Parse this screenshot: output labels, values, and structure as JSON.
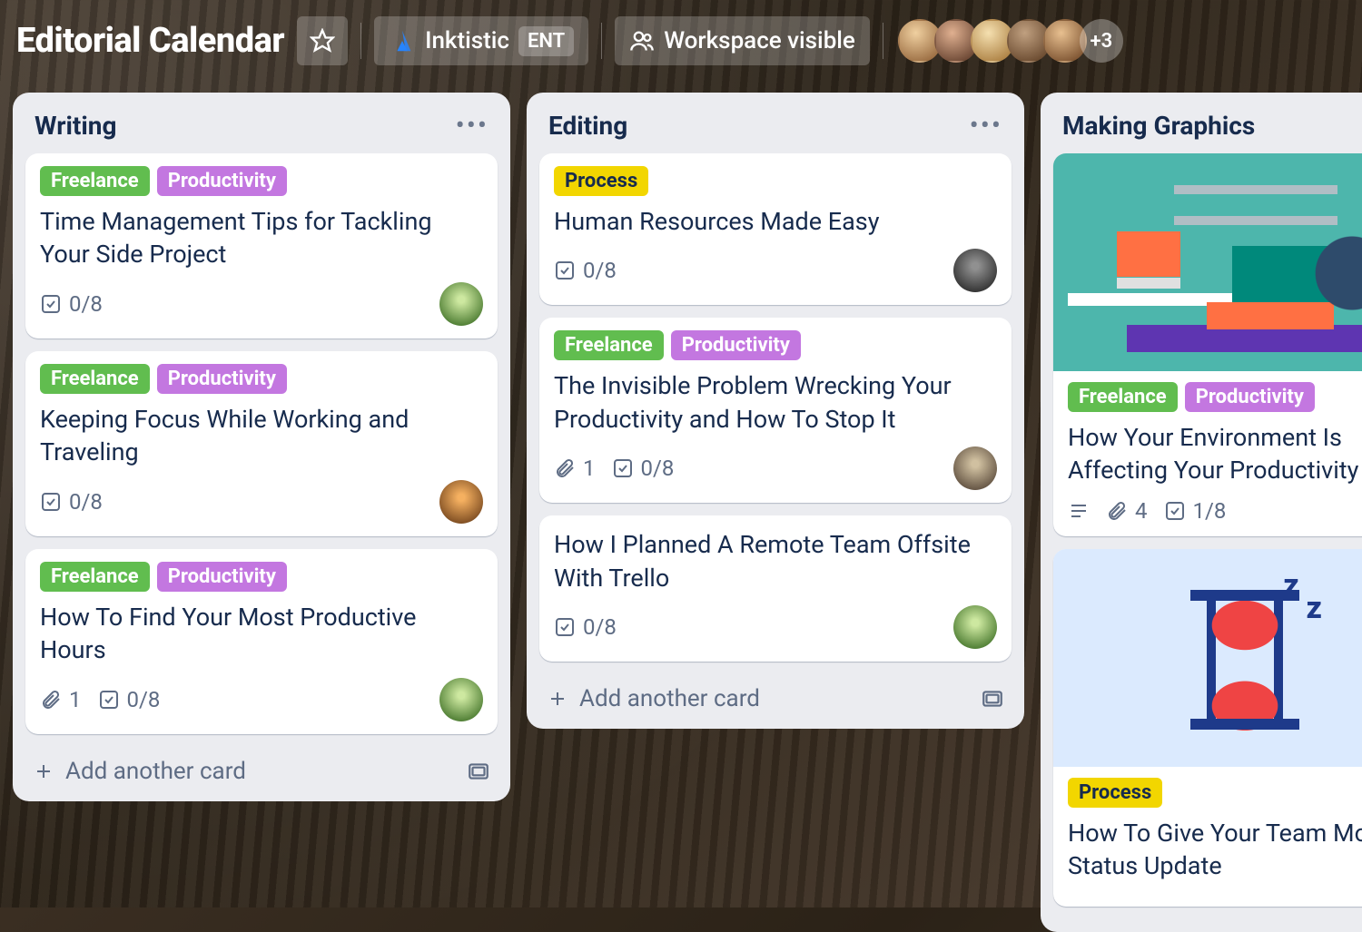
{
  "header": {
    "board_title": "Editorial Calendar",
    "workspace_name": "Inktistic",
    "workspace_badge": "ENT",
    "visibility_label": "Workspace visible",
    "more_members": "+3"
  },
  "labels": {
    "freelance": "Freelance",
    "productivity": "Productivity",
    "process": "Process"
  },
  "add_card_label": "Add another card",
  "lists": [
    {
      "title": "Writing",
      "cards": [
        {
          "labels": [
            "freelance",
            "productivity"
          ],
          "title": "Time Management Tips for Tackling Your Side Project",
          "checklist": "0/8",
          "attachments": null,
          "avatar": "av-green"
        },
        {
          "labels": [
            "freelance",
            "productivity"
          ],
          "title": "Keeping Focus While Working and Traveling",
          "checklist": "0/8",
          "attachments": null,
          "avatar": "av-orange"
        },
        {
          "labels": [
            "freelance",
            "productivity"
          ],
          "title": "How To Find Your Most Productive Hours",
          "checklist": "0/8",
          "attachments": "1",
          "avatar": "av-green"
        }
      ]
    },
    {
      "title": "Editing",
      "cards": [
        {
          "labels": [
            "process"
          ],
          "title": "Human Resources Made Easy",
          "checklist": "0/8",
          "attachments": null,
          "avatar": "av-dark"
        },
        {
          "labels": [
            "freelance",
            "productivity"
          ],
          "title": "The Invisible Problem Wrecking Your Productivity and How To Stop It",
          "checklist": "0/8",
          "attachments": "1",
          "avatar": "av-hat"
        },
        {
          "labels": [],
          "title": "How I Planned A Remote Team Offsite With Trello",
          "checklist": "0/8",
          "attachments": null,
          "avatar": "av-green"
        }
      ]
    },
    {
      "title": "Making Graphics",
      "cards": [
        {
          "cover": "cover1",
          "labels": [
            "freelance",
            "productivity"
          ],
          "title": "How Your Environment Is Affecting Your Productivity",
          "checklist": "1/8",
          "attachments": "4",
          "has_description": true
        },
        {
          "cover": "cover2",
          "labels": [
            "process"
          ],
          "title": "How To Give Your Team Monthly Status Update",
          "checklist": null,
          "attachments": null
        }
      ]
    }
  ]
}
